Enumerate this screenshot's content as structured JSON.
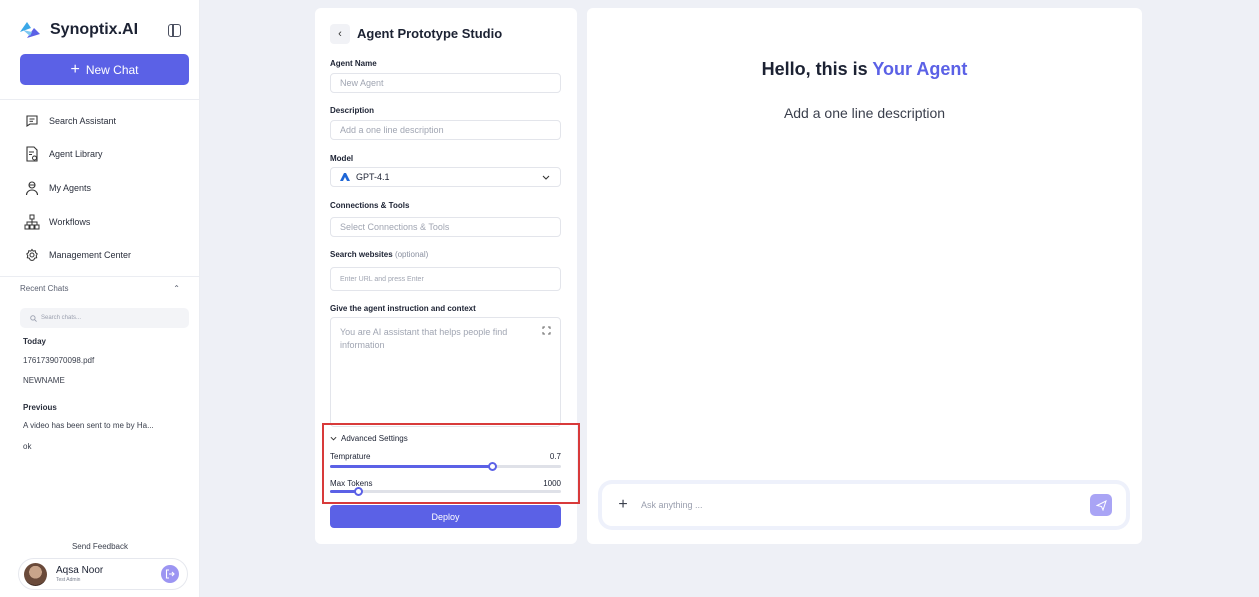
{
  "brand": {
    "name": "Synoptix.AI"
  },
  "sidebar": {
    "new_chat_label": "New Chat",
    "items": [
      {
        "label": "Search Assistant",
        "icon": "chat-bubble-icon"
      },
      {
        "label": "Agent Library",
        "icon": "document-icon"
      },
      {
        "label": "My Agents",
        "icon": "agent-icon"
      },
      {
        "label": "Workflows",
        "icon": "workflow-icon"
      },
      {
        "label": "Management Center",
        "icon": "gear-icon"
      }
    ],
    "recent_chats_label": "Recent Chats",
    "search_placeholder": "Search chats...",
    "groups": [
      {
        "title": "Today",
        "chats": [
          "1761739070098.pdf",
          "NEWNAME"
        ]
      },
      {
        "title": "Previous",
        "chats": [
          "A video has been sent to me by Ha...",
          "ok"
        ]
      }
    ],
    "feedback_label": "Send Feedback",
    "user": {
      "name": "Aqsa Noor",
      "role": "Test Admin"
    }
  },
  "config": {
    "title": "Agent Prototype Studio",
    "agent_name": {
      "label": "Agent Name",
      "placeholder": "New Agent"
    },
    "description": {
      "label": "Description",
      "placeholder": "Add a one line description"
    },
    "model": {
      "label": "Model",
      "value": "GPT-4.1"
    },
    "connections": {
      "label": "Connections & Tools",
      "placeholder": "Select Connections & Tools"
    },
    "websites": {
      "label": "Search websites",
      "optional": "(optional)",
      "placeholder": "Enter URL and press Enter"
    },
    "instructions": {
      "label": "Give the agent instruction and context",
      "placeholder": "You are AI assistant that helps people find information"
    },
    "advanced": {
      "label": "Advanced Settings",
      "temperature": {
        "label": "Temprature",
        "value": "0.7",
        "fraction": 0.7
      },
      "max_tokens": {
        "label": "Max Tokens",
        "value": "1000",
        "fraction": 0.12
      }
    },
    "deploy_label": "Deploy"
  },
  "preview": {
    "greeting_prefix": "Hello, this is",
    "greeting_accent": "Your Agent",
    "description": "Add a one line description",
    "ask_placeholder": "Ask anything ..."
  },
  "colors": {
    "accent": "#5b61e6",
    "highlight": "#d83a3a"
  }
}
